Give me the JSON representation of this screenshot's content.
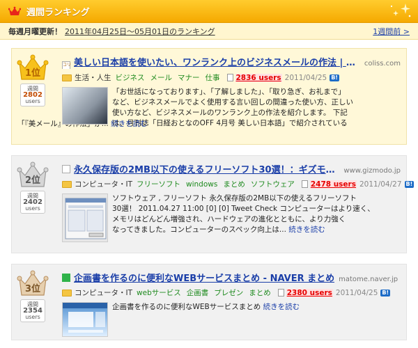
{
  "header": {
    "title": "週間ランキング"
  },
  "subbar": {
    "lead": "毎週月曜更新！",
    "range": "2011年04月25日〜05月01日のランキング",
    "prev": "1週間前 >"
  },
  "entries": [
    {
      "rank": "1位",
      "users_label": "users",
      "users_top": "週間",
      "users_num": "2802",
      "title": "美しい日本語を使いたい、ワンランク上のビジネスメールの作法 | コ...",
      "domain": "coliss.com",
      "category": "生活・人生",
      "tags": [
        "ビジネス",
        "メール",
        "マナー",
        "仕事"
      ],
      "count": "2836 users",
      "date": "2011/04/25",
      "desc_lines": [
        "「お世話になっております」、「了解しました」、「取り急ぎ、お礼まで」",
        "など、ビジネスメールでよく使用する言い回しの間違った使い方、正しい",
        "使い方など、ビジネスメールのワンランク上の作法を紹介します。 下記",
        "は、月刊誌「日経おとなのOFF 4月号 美しい日本語」で紹介されている"
      ],
      "desc_tail": "「『美メール』の作法」か...",
      "more": "続きを読む"
    },
    {
      "rank": "2位",
      "users_label": "users",
      "users_top": "週間",
      "users_num": "2402",
      "title": "永久保存版の2MB以下の使えるフリーソフト30選！：ギズモード・ジャ...",
      "domain": "www.gizmodo.jp",
      "category": "コンピュータ・IT",
      "tags": [
        "フリーソフト",
        "windows",
        "まとめ",
        "ソフトウェア"
      ],
      "count": "2478 users",
      "date": "2011/04/27",
      "desc_lines": [
        "ソフトウェア , フリーソフト 永久保存版の2MB以下の使えるフリーソフト",
        "30選！ 2011.04.27 11:00 [0] [0] Tweet Check コンピューターはより速く、",
        "メモリはどんどん増強され、ハードウェアの進化とともに、より力強く"
      ],
      "desc_tail": "なってきました。コンピューターのスペック向上は...",
      "more": "続きを読む"
    },
    {
      "rank": "3位",
      "users_label": "users",
      "users_top": "週間",
      "users_num": "2354",
      "title": "企画書を作るのに便利なWEBサービスまとめ - NAVER まとめ",
      "domain": "matome.naver.jp",
      "category": "コンピュータ・IT",
      "tags": [
        "webサービス",
        "企画書",
        "プレゼン",
        "まとめ"
      ],
      "count": "2380 users",
      "date": "2011/04/25",
      "desc_lines": [],
      "desc_tail": "企画書を作るのに便利なWEBサービスまとめ",
      "more": "続きを読む"
    }
  ],
  "colors": {
    "header_bg": "#f5a900",
    "gold_card": "#fff8d8",
    "gray_card": "#f1f1f1",
    "link": "#1a3ea8",
    "tag": "#1e8a1e",
    "count": "#e60000"
  }
}
